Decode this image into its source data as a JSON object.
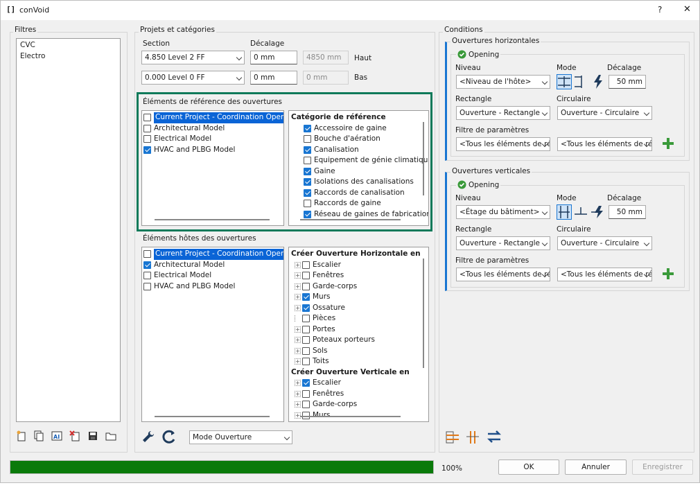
{
  "window": {
    "app_icon": "[]",
    "title": "conVoid",
    "help": "?",
    "close": "✕"
  },
  "filters": {
    "label": "Filtres",
    "items": [
      "CVC",
      "Electro"
    ]
  },
  "projects": {
    "label": "Projets et catégories",
    "section_label": "Section",
    "offset_label": "Décalage",
    "top": {
      "level": "4.850  Level 2 FF",
      "offset": "0 mm",
      "computed": "4850 mm",
      "side": "Haut"
    },
    "bottom": {
      "level": "0.000  Level 0 FF",
      "offset": "0 mm",
      "computed": "0 mm",
      "side": "Bas"
    }
  },
  "reference": {
    "label": "Éléments de référence des ouvertures",
    "models": [
      {
        "name": "Current Project - Coordination Openings",
        "checked": false,
        "selected": true
      },
      {
        "name": "Architectural Model",
        "checked": false
      },
      {
        "name": "Electrical Model",
        "checked": false
      },
      {
        "name": "HVAC and PLBG Model",
        "checked": true
      }
    ],
    "category_header": "Catégorie de référence",
    "categories": [
      {
        "name": "Accessoire de gaine",
        "checked": true
      },
      {
        "name": "Bouche d'aération",
        "checked": false
      },
      {
        "name": "Canalisation",
        "checked": true
      },
      {
        "name": "Equipement de génie climatique",
        "checked": false
      },
      {
        "name": "Gaine",
        "checked": true
      },
      {
        "name": "Isolations des canalisations",
        "checked": true
      },
      {
        "name": "Raccords de canalisation",
        "checked": true
      },
      {
        "name": "Raccords de gaine",
        "checked": false
      },
      {
        "name": "Réseau de gaines de fabrication M",
        "checked": true
      }
    ]
  },
  "hosts": {
    "label": "Éléments hôtes des ouvertures",
    "models": [
      {
        "name": "Current Project - Coordination Openings",
        "checked": false,
        "selected": true
      },
      {
        "name": "Architectural Model",
        "checked": true
      },
      {
        "name": "Electrical Model",
        "checked": false
      },
      {
        "name": "HVAC and PLBG Model",
        "checked": false
      }
    ],
    "horizontal_header": "Créer Ouverture Horizontale en",
    "horizontal": [
      {
        "name": "Escalier",
        "checked": false
      },
      {
        "name": "Fenêtres",
        "checked": false
      },
      {
        "name": "Garde-corps",
        "checked": false
      },
      {
        "name": "Murs",
        "checked": true
      },
      {
        "name": "Ossature",
        "checked": true
      },
      {
        "name": "Pièces",
        "checked": false,
        "noexp": true
      },
      {
        "name": "Portes",
        "checked": false
      },
      {
        "name": "Poteaux porteurs",
        "checked": false
      },
      {
        "name": "Sols",
        "checked": false
      },
      {
        "name": "Toits",
        "checked": false
      }
    ],
    "vertical_header": "Créer Ouverture Verticale en",
    "vertical": [
      {
        "name": "Escalier",
        "checked": true
      },
      {
        "name": "Fenêtres",
        "checked": false
      },
      {
        "name": "Garde-corps",
        "checked": false
      },
      {
        "name": "Murs",
        "checked": false
      }
    ]
  },
  "mode_select": "Mode Ouverture",
  "conditions": {
    "label": "Conditions",
    "horizontal": {
      "label": "Ouvertures horizontales",
      "opening": "Opening",
      "niveau_label": "Niveau",
      "mode_label": "Mode",
      "offset_label": "Décalage",
      "niveau": "<Niveau de l'hôte>",
      "offset": "50 mm",
      "rect_label": "Rectangle",
      "circ_label": "Circulaire",
      "rect": "Ouverture - Rectangle",
      "circ": "Ouverture - Circulaire",
      "filter_label": "Filtre de paramètres",
      "filter1": "<Tous les éléments de réf",
      "filter2": "<Tous les éléments de réf"
    },
    "vertical": {
      "label": "Ouvertures verticales",
      "opening": "Opening",
      "niveau_label": "Niveau",
      "mode_label": "Mode",
      "offset_label": "Décalage",
      "niveau": "<Étage du bâtiment>",
      "offset": "50 mm",
      "rect_label": "Rectangle",
      "circ_label": "Circulaire",
      "rect": "Ouverture - Rectangle",
      "circ": "Ouverture - Circulaire",
      "filter_label": "Filtre de paramètres",
      "filter1": "<Tous les éléments de réf",
      "filter2": "<Tous les éléments de réf"
    }
  },
  "progress": {
    "value": 1.0,
    "text": "100%",
    "color": "#0a7a0a"
  },
  "buttons": {
    "ok": "OK",
    "cancel": "Annuler",
    "save": "Enregistrer"
  },
  "colors": {
    "highlight_border": "#0f7a5a",
    "selection": "#0a64d6",
    "check": "#1976d2"
  }
}
